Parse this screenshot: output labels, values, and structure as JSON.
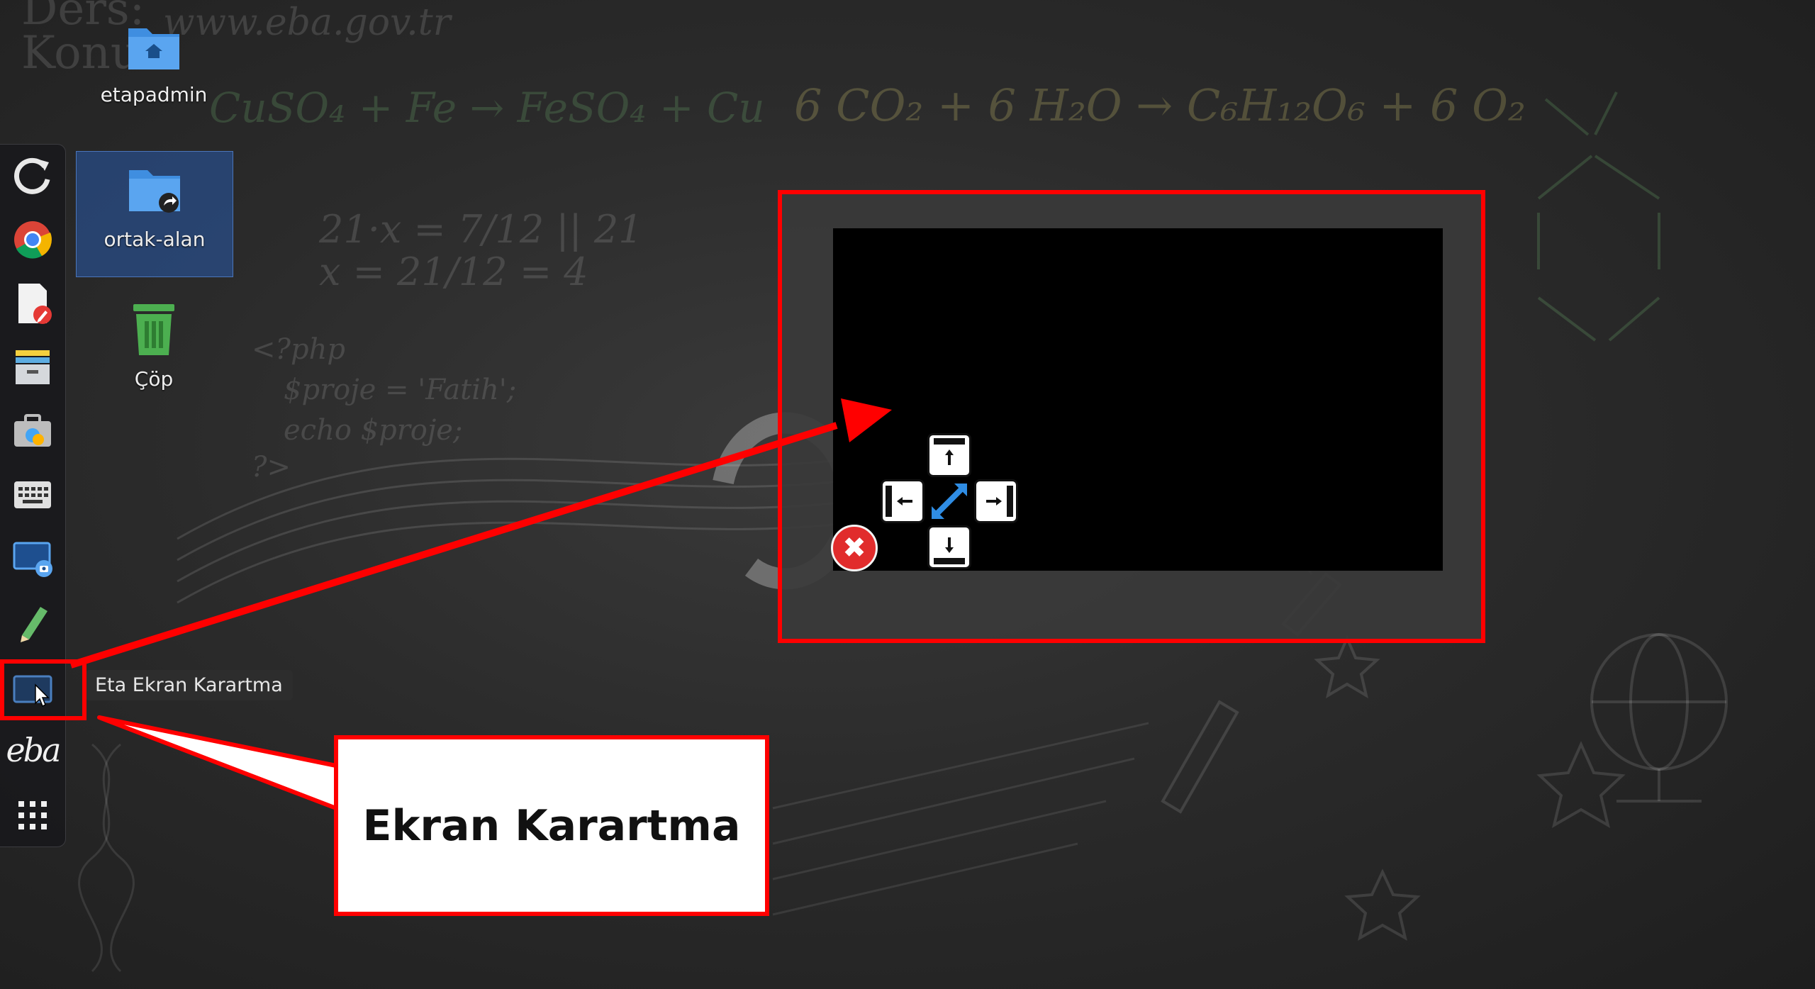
{
  "desktop": {
    "icons": [
      {
        "label": "etapadmin",
        "icon": "home-folder-icon"
      },
      {
        "label": "ortak-alan",
        "icon": "shared-folder-icon"
      },
      {
        "label": "Çöp",
        "icon": "trash-icon"
      }
    ],
    "wallpaper": {
      "url": "www.eba.gov.tr",
      "corner": "Ders:\nKonu",
      "eq1": "CuSO₄ + Fe → FeSO₄ + Cu",
      "eq2": "6 CO₂ + 6 H₂O → C₆H₁₂O₆ + 6 O₂",
      "math1": "21·x = 7/12 || 21",
      "math2": "x = 21/12 = 4",
      "code1": "<?php",
      "code2": "$proje = 'Fatih';",
      "code3": "echo $proje;",
      "code4": "?>"
    }
  },
  "dock": {
    "items": [
      {
        "name": "refresh-icon"
      },
      {
        "name": "chrome-icon"
      },
      {
        "name": "pdf-editor-icon"
      },
      {
        "name": "files-icon"
      },
      {
        "name": "toolbox-icon"
      },
      {
        "name": "keyboard-icon"
      },
      {
        "name": "screenshot-icon"
      },
      {
        "name": "pencil-icon"
      },
      {
        "name": "eta-screen-dimmer-icon"
      },
      {
        "name": "eba-icon"
      },
      {
        "name": "app-grid-icon"
      }
    ],
    "tooltip": "Eta Ekran Karartma",
    "eba_logo_text": "eba"
  },
  "annotation": {
    "label": "Ekran Karartma",
    "color": "#ff0000"
  },
  "dimmer_preview": {
    "close_symbol": "✖"
  }
}
